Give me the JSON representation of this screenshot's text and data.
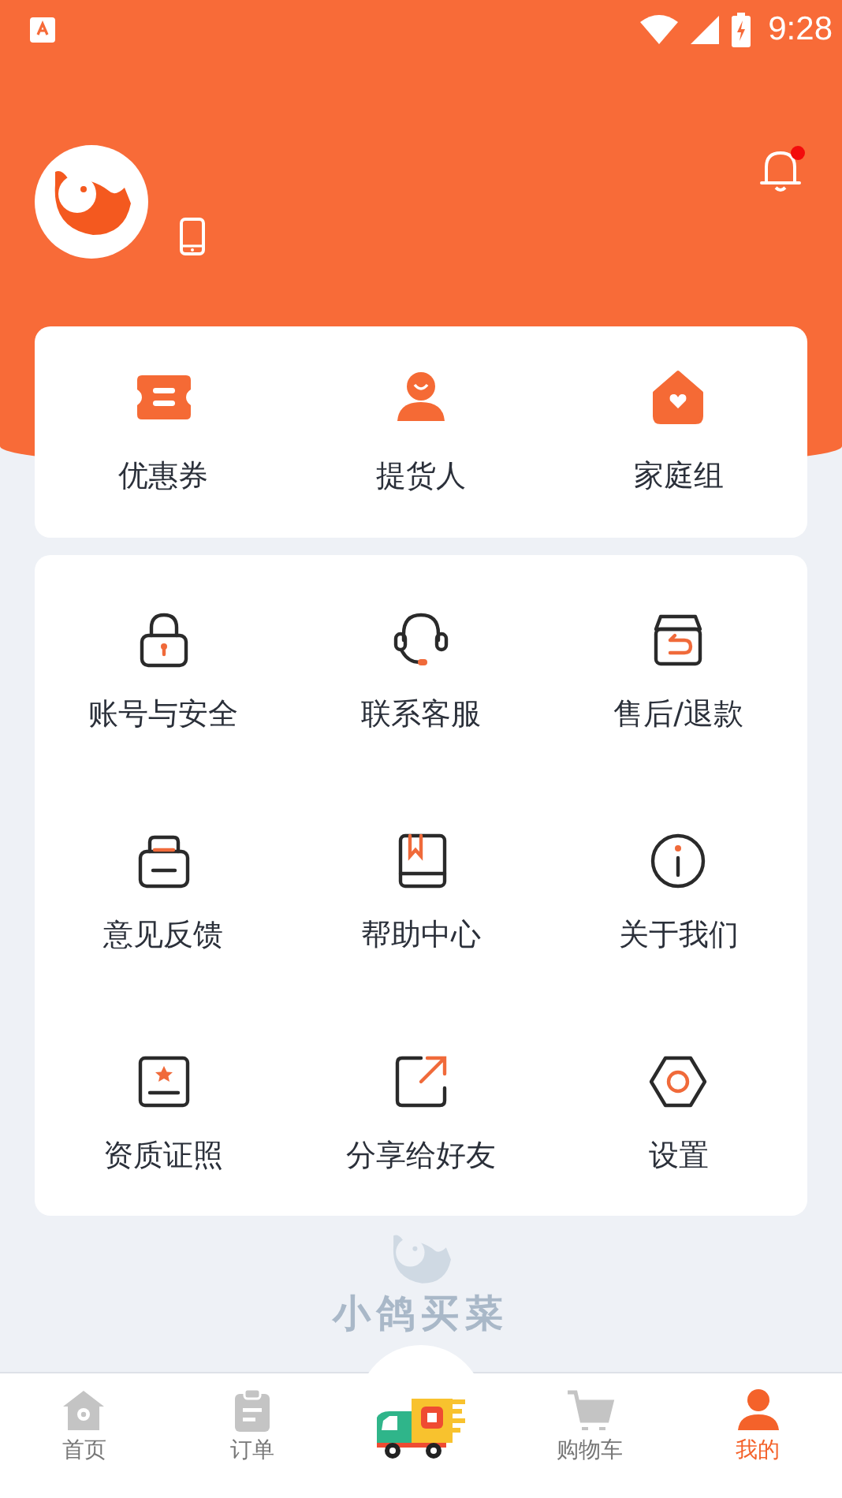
{
  "status_bar": {
    "time": "9:28"
  },
  "header": {
    "notification_unread": true
  },
  "quick_actions": [
    {
      "label": "优惠券"
    },
    {
      "label": "提货人"
    },
    {
      "label": "家庭组"
    }
  ],
  "services": [
    {
      "label": "账号与安全"
    },
    {
      "label": "联系客服"
    },
    {
      "label": "售后/退款"
    },
    {
      "label": "意见反馈"
    },
    {
      "label": "帮助中心"
    },
    {
      "label": "关于我们"
    },
    {
      "label": "资质证照"
    },
    {
      "label": "分享给好友"
    },
    {
      "label": "设置"
    }
  ],
  "footer_brand": {
    "name": "小鸽买菜"
  },
  "bottom_nav": [
    {
      "kind": "tab",
      "label": "首页",
      "selected": false
    },
    {
      "kind": "tab",
      "label": "订单",
      "selected": false
    },
    {
      "kind": "center"
    },
    {
      "kind": "tab",
      "label": "购物车",
      "selected": false
    },
    {
      "kind": "tab",
      "label": "我的",
      "selected": true
    }
  ]
}
